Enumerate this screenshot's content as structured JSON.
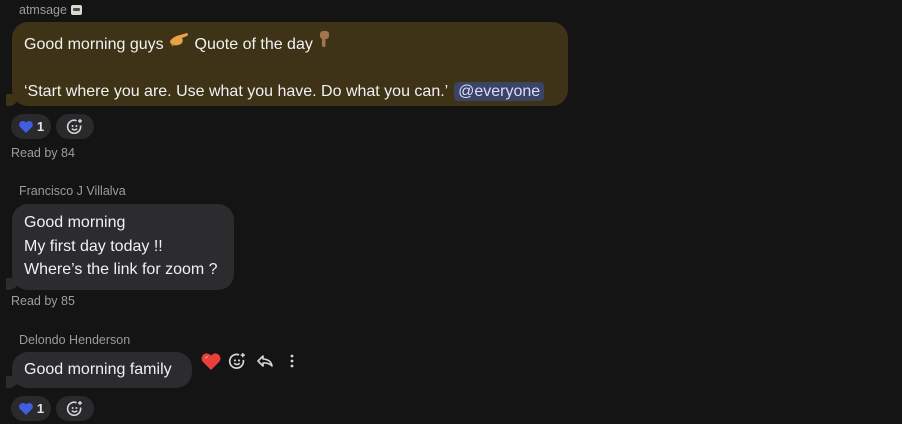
{
  "messages": [
    {
      "sender": "atmsage",
      "lines": [
        "Good morning guys",
        "Quote of the day"
      ],
      "quote": "‘Start where you are. Use what you have. Do what you can.’",
      "mention": "@everyone",
      "reaction_count": "1",
      "read_by": "Read by 84",
      "bubble_color": "#3e3316"
    },
    {
      "sender": "Francisco J Villalva",
      "lines": [
        "Good morning",
        "My first day today !!",
        "Where’s the link for zoom ?"
      ],
      "read_by": "Read by 85",
      "bubble_color": "#2c2c2e"
    },
    {
      "sender": "Delondo Henderson",
      "lines": [
        "Good morning family"
      ],
      "reaction_count": "1",
      "bubble_color": "#2c2c2e"
    }
  ],
  "hover_actions": [
    "heart-react",
    "add-reaction",
    "reply",
    "more-options"
  ],
  "colors": {
    "background": "#141414",
    "mention_bg": "#3c4466",
    "reaction_heart": "#3f5fe0",
    "hover_heart": "#e8413c"
  }
}
